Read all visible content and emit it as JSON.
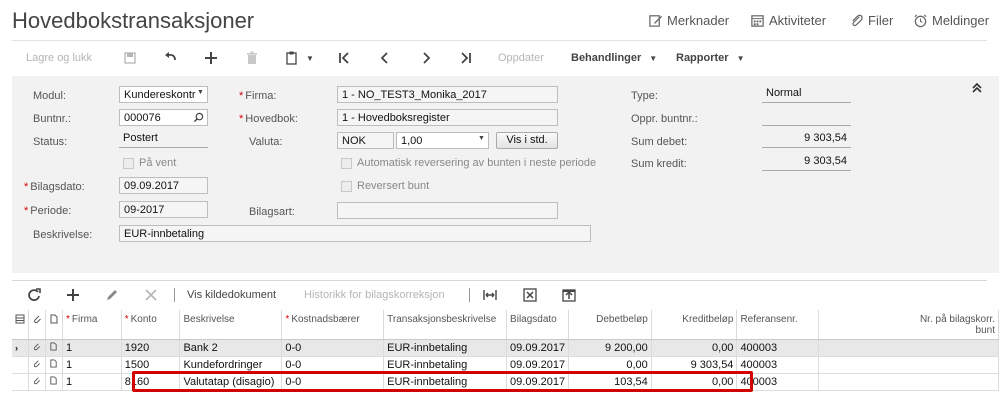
{
  "page": {
    "title": "Hovedbokstransaksjoner",
    "header_actions": [
      "Merknader",
      "Aktiviteter",
      "Filer",
      "Meldinger"
    ]
  },
  "toolbar": {
    "save_close": "Lagre og lukk",
    "update": "Oppdater",
    "behandlinger": "Behandlinger",
    "rapporter": "Rapporter"
  },
  "form": {
    "modul_label": "Modul:",
    "modul_value": "Kundereskontr",
    "buntnr_label": "Buntnr.:",
    "buntnr_value": "000076",
    "status_label": "Status:",
    "status_value": "Postert",
    "pa_vent_label": "På vent",
    "bilagsdato_label": "Bilagsdato:",
    "bilagsdato_value": "09.09.2017",
    "periode_label": "Periode:",
    "periode_value": "09-2017",
    "beskrivelse_label": "Beskrivelse:",
    "beskrivelse_value": "EUR-innbetaling",
    "firma_label": "Firma:",
    "firma_value": "1 - NO_TEST3_Monika_2017",
    "hovedbok_label": "Hovedbok:",
    "hovedbok_value": "1 - Hovedboksregister",
    "valuta_label": "Valuta:",
    "valuta_value": "NOK",
    "kurs_value": "1,00",
    "vis_std_label": "Vis i std.",
    "auto_rev_label": "Automatisk reversering av bunten i neste periode",
    "reversert_label": "Reversert bunt",
    "bilagsart_label": "Bilagsart:",
    "bilagsart_value": "",
    "type_label": "Type:",
    "type_value": "Normal",
    "oppr_buntnr_label": "Oppr. buntnr.:",
    "oppr_buntnr_value": "",
    "sum_debet_label": "Sum debet:",
    "sum_debet_value": "9 303,54",
    "sum_kredit_label": "Sum kredit:",
    "sum_kredit_value": "9 303,54"
  },
  "grid_toolbar": {
    "vis_kildedokument": "Vis kildedokument",
    "historikk": "Historikk for bilagskorreksjon"
  },
  "grid": {
    "headers": {
      "firma": "Firma",
      "konto": "Konto",
      "beskrivelse": "Beskrivelse",
      "kostnadsbaerer": "Kostnadsbærer",
      "transaksjonsbeskrivelse": "Transaksjonsbeskrivelse",
      "bilagsdato": "Bilagsdato",
      "debetbelop": "Debetbeløp",
      "kreditbelop": "Kreditbeløp",
      "referansenr": "Referansenr.",
      "nr_bilagskorr_1": "Nr. på bilagskorr.",
      "nr_bilagskorr_2": "bunt"
    },
    "rows": [
      {
        "firma": "1",
        "konto": "1920",
        "beskrivelse": "Bank 2",
        "kostnadsbaerer": "0-0",
        "trans": "EUR-innbetaling",
        "dato": "09.09.2017",
        "debet": "9 200,00",
        "kredit": "0,00",
        "ref": "400003",
        "nr": ""
      },
      {
        "firma": "1",
        "konto": "1500",
        "beskrivelse": "Kundefordringer",
        "kostnadsbaerer": "0-0",
        "trans": "EUR-innbetaling",
        "dato": "09.09.2017",
        "debet": "0,00",
        "kredit": "9 303,54",
        "ref": "400003",
        "nr": ""
      },
      {
        "firma": "1",
        "konto": "8160",
        "beskrivelse": "Valutatap (disagio)",
        "kostnadsbaerer": "0-0",
        "trans": "EUR-innbetaling",
        "dato": "09.09.2017",
        "debet": "103,54",
        "kredit": "0,00",
        "ref": "400003",
        "nr": ""
      }
    ]
  },
  "colors": {
    "highlight": "#d40000",
    "panel": "#f2f2f2"
  }
}
